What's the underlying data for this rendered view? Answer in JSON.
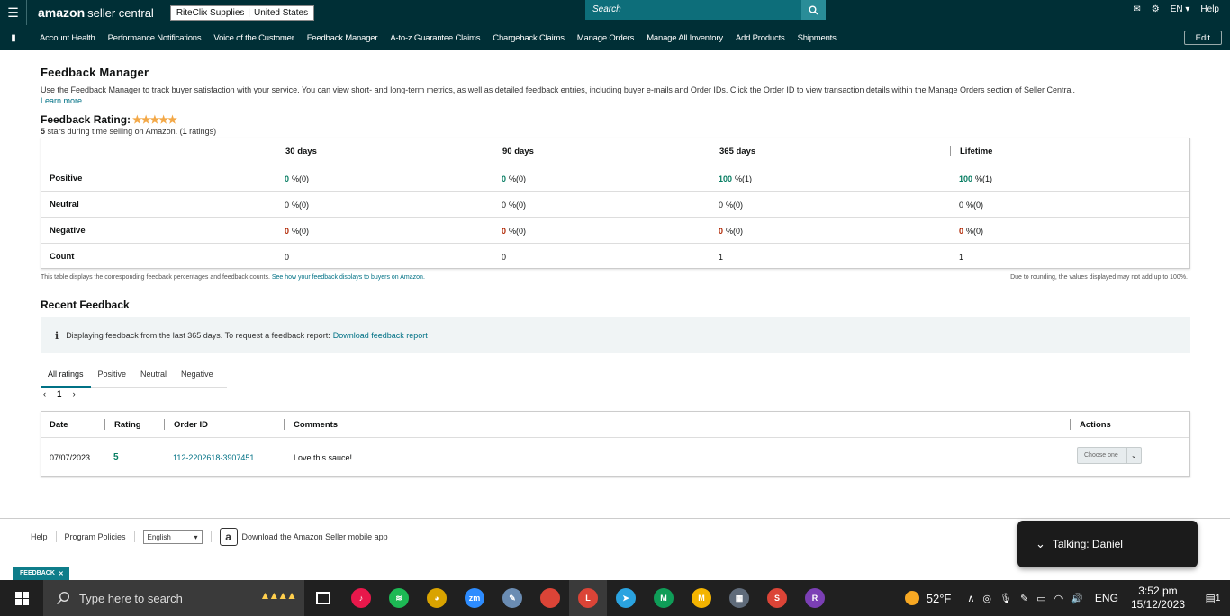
{
  "topbar": {
    "logo_main": "amazon",
    "logo_sub": "seller central",
    "store_name": "RiteClix Supplies",
    "marketplace": "United States",
    "search_placeholder": "Search",
    "language": "EN",
    "help": "Help"
  },
  "nav": {
    "items": [
      "Account Health",
      "Performance Notifications",
      "Voice of the Customer",
      "Feedback Manager",
      "A-to-z Guarantee Claims",
      "Chargeback Claims",
      "Manage Orders",
      "Manage All Inventory",
      "Add Products",
      "Shipments"
    ],
    "edit": "Edit"
  },
  "page": {
    "title": "Feedback Manager",
    "intro": "Use the Feedback Manager to track buyer satisfaction with your service. You can view short- and long-term metrics, as well as detailed feedback entries, including buyer e-mails and Order IDs. Click the Order ID to view transaction details within the Manage Orders section of Seller Central.",
    "learn_more": "Learn more",
    "rating_label": "Feedback Rating:",
    "stars": "★★★★★",
    "rating_count_stars": "5",
    "rating_sub_mid": "stars during time selling on Amazon. (",
    "rating_count": "1",
    "rating_sub_end": "ratings)"
  },
  "metrics": {
    "headers": [
      "30 days",
      "90 days",
      "365 days",
      "Lifetime"
    ],
    "rows": [
      {
        "label": "Positive",
        "cells": [
          {
            "v": "0",
            "s": "%(0)"
          },
          {
            "v": "0",
            "s": "%(0)"
          },
          {
            "v": "100",
            "s": "%(1)"
          },
          {
            "v": "100",
            "s": "%(1)"
          }
        ]
      },
      {
        "label": "Neutral",
        "cells": [
          {
            "v": "0",
            "s": "%(0)"
          },
          {
            "v": "0",
            "s": "%(0)"
          },
          {
            "v": "0",
            "s": "%(0)"
          },
          {
            "v": "0",
            "s": "%(0)"
          }
        ]
      },
      {
        "label": "Negative",
        "cells": [
          {
            "v": "0",
            "s": "%(0)"
          },
          {
            "v": "0",
            "s": "%(0)"
          },
          {
            "v": "0",
            "s": "%(0)"
          },
          {
            "v": "0",
            "s": "%(0)"
          }
        ]
      },
      {
        "label": "Count",
        "cells": [
          {
            "v": "0",
            "s": ""
          },
          {
            "v": "0",
            "s": ""
          },
          {
            "v": "1",
            "s": ""
          },
          {
            "v": "1",
            "s": ""
          }
        ]
      }
    ],
    "footnote_left": "This table displays the corresponding feedback percentages and feedback counts.",
    "footnote_link": "See how your feedback displays to buyers on Amazon.",
    "footnote_right": "Due to rounding, the values displayed may not add up to 100%."
  },
  "recent": {
    "title": "Recent Feedback",
    "info_text": "Displaying feedback from the last 365 days. To request a feedback report:",
    "info_link": "Download feedback report",
    "tabs": [
      "All ratings",
      "Positive",
      "Neutral",
      "Negative"
    ],
    "page_prev": "‹",
    "page_num": "1",
    "page_next": "›",
    "headers": {
      "date": "Date",
      "rating": "Rating",
      "order": "Order ID",
      "comments": "Comments",
      "actions": "Actions"
    },
    "row": {
      "date": "07/07/2023",
      "rating": "5",
      "order": "112-2202618-3907451",
      "comment": "Love this sauce!",
      "action": "Choose one"
    }
  },
  "footer": {
    "help": "Help",
    "policies": "Program Policies",
    "language": "English",
    "app_text": "Download the Amazon Seller mobile app"
  },
  "call": {
    "text": "Talking: Daniel"
  },
  "feedback_tab": "FEEDBACK",
  "taskbar": {
    "search": "Type here to search",
    "temp": "52°F",
    "lang": "ENG",
    "time": "3:52 pm",
    "date": "15/12/2023",
    "notif_count": "1",
    "icons": [
      {
        "name": "task-view-icon",
        "label": "",
        "color": "#202020"
      },
      {
        "name": "tiktok-icon",
        "label": "♪",
        "color": "#e8184b"
      },
      {
        "name": "spotify-icon",
        "label": "≋",
        "color": "#1db954"
      },
      {
        "name": "game-icon",
        "label": "◕",
        "color": "#d9a300"
      },
      {
        "name": "zoom-icon",
        "label": "zm",
        "color": "#2d8cff"
      },
      {
        "name": "paint-icon",
        "label": "✎",
        "color": "#6a8cb3"
      },
      {
        "name": "chrome-icon",
        "label": "",
        "color": "#db4437"
      },
      {
        "name": "chrome-profile-l-icon",
        "label": "L",
        "color": "#db4437"
      },
      {
        "name": "telegram-icon",
        "label": "➤",
        "color": "#2aa3e0"
      },
      {
        "name": "chrome-profile-m-icon",
        "label": "M",
        "color": "#0f9d58"
      },
      {
        "name": "chrome-profile-m2-icon",
        "label": "M",
        "color": "#f4b400"
      },
      {
        "name": "calculator-icon",
        "label": "▦",
        "color": "#5f6b7a"
      },
      {
        "name": "chrome-profile-s-icon",
        "label": "S",
        "color": "#db4437"
      },
      {
        "name": "chrome-profile-r-icon",
        "label": "R",
        "color": "#7b3fb5"
      }
    ]
  }
}
